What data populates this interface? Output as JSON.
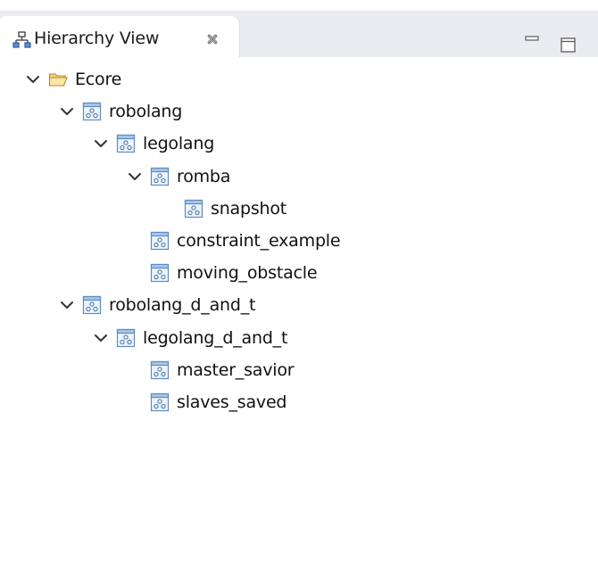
{
  "view": {
    "title": "Hierarchy View",
    "tab_icon": "hierarchy-icon",
    "close_icon": "close-icon",
    "minimize_icon": "minimize-icon",
    "maximize_icon": "maximize-icon"
  },
  "tree": {
    "nodes": [
      {
        "label": "Ecore",
        "depth": 0,
        "expanded": true,
        "icon": "folder-open-icon"
      },
      {
        "label": "robolang",
        "depth": 1,
        "expanded": true,
        "icon": "package-icon"
      },
      {
        "label": "legolang",
        "depth": 2,
        "expanded": true,
        "icon": "package-icon"
      },
      {
        "label": "romba",
        "depth": 3,
        "expanded": true,
        "icon": "package-icon"
      },
      {
        "label": "snapshot",
        "depth": 4,
        "expanded": false,
        "icon": "package-icon"
      },
      {
        "label": "constraint_example",
        "depth": 3,
        "expanded": false,
        "icon": "package-icon"
      },
      {
        "label": "moving_obstacle",
        "depth": 3,
        "expanded": false,
        "icon": "package-icon"
      },
      {
        "label": "robolang_d_and_t",
        "depth": 1,
        "expanded": true,
        "icon": "package-icon"
      },
      {
        "label": "legolang_d_and_t",
        "depth": 2,
        "expanded": true,
        "icon": "package-icon"
      },
      {
        "label": "master_savior",
        "depth": 3,
        "expanded": false,
        "icon": "package-icon"
      },
      {
        "label": "slaves_saved",
        "depth": 3,
        "expanded": false,
        "icon": "package-icon"
      }
    ]
  },
  "colors": {
    "tabbar_bg": "#eaecef",
    "folder": "#e8b84a",
    "package_border": "#4a7fb5",
    "chevron": "#333333"
  }
}
